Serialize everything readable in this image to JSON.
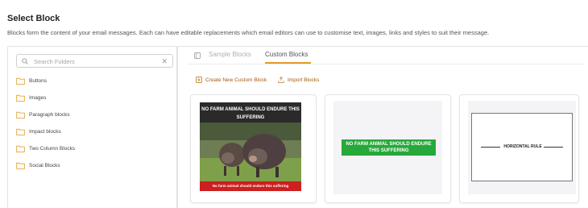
{
  "header": {
    "title": "Select Block",
    "description": "Blocks form the content of your email messages. Each can have editable replacements which email editors can use to customise text, images, links and styles to suit their message."
  },
  "sidebar": {
    "search_placeholder": "Search Folders",
    "folders": [
      {
        "label": "Buttons"
      },
      {
        "label": "Images"
      },
      {
        "label": "Paragraph blocks"
      },
      {
        "label": "Impact blocks"
      },
      {
        "label": "Two Column Blocks"
      },
      {
        "label": "Social Blocks"
      }
    ]
  },
  "tabs": {
    "sample": "Sample Blocks",
    "custom": "Custom Blocks",
    "active": "custom"
  },
  "actions": {
    "create": "Create New Custom Block",
    "import": "Import Blocks"
  },
  "blocks": [
    {
      "headline": "NO FARM ANIMAL SHOULD ENDURE THIS SUFFERING",
      "footer": "No farm animal should endure this suffering"
    },
    {
      "banner": "NO FARM ANIMAL SHOULD ENDURE THIS SUFFERING"
    },
    {
      "label": "HORIZONTAL RULE"
    }
  ],
  "colors": {
    "accent": "#e39b2a",
    "action_text": "#a6590d",
    "folder_icon": "#e3a53b",
    "banner_green": "#27a83a",
    "footer_red": "#cc1f1f"
  },
  "icons": [
    "search-icon",
    "clear-icon",
    "folder-icon",
    "sample-blocks-icon",
    "add-icon",
    "import-icon"
  ]
}
